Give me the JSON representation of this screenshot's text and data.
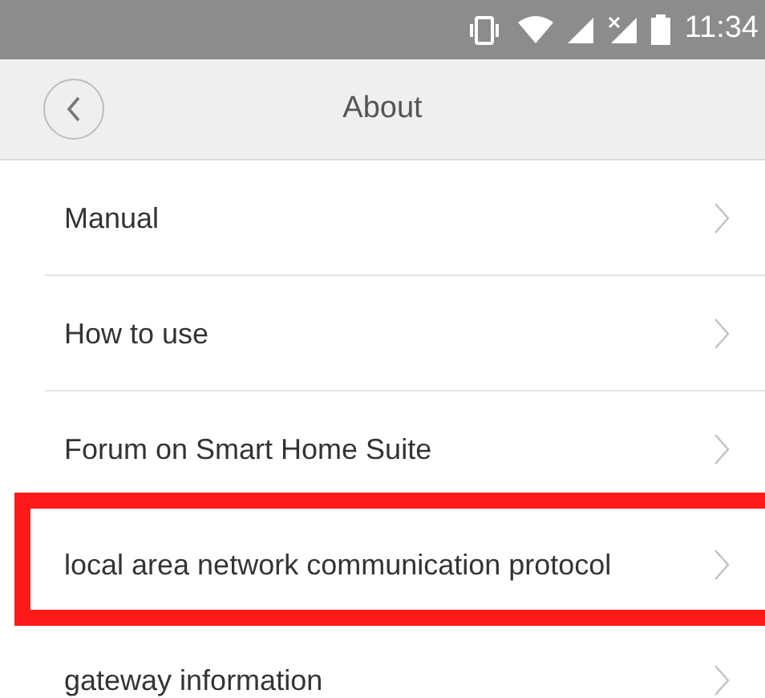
{
  "status_bar": {
    "time": "11:34"
  },
  "header": {
    "title": "About"
  },
  "items": [
    {
      "label": "Manual",
      "highlighted": false
    },
    {
      "label": "How to use",
      "highlighted": false
    },
    {
      "label": "Forum on Smart Home Suite",
      "highlighted": false
    },
    {
      "label": "local area network communication protocol",
      "highlighted": true
    },
    {
      "label": "gateway information",
      "highlighted": false
    }
  ]
}
